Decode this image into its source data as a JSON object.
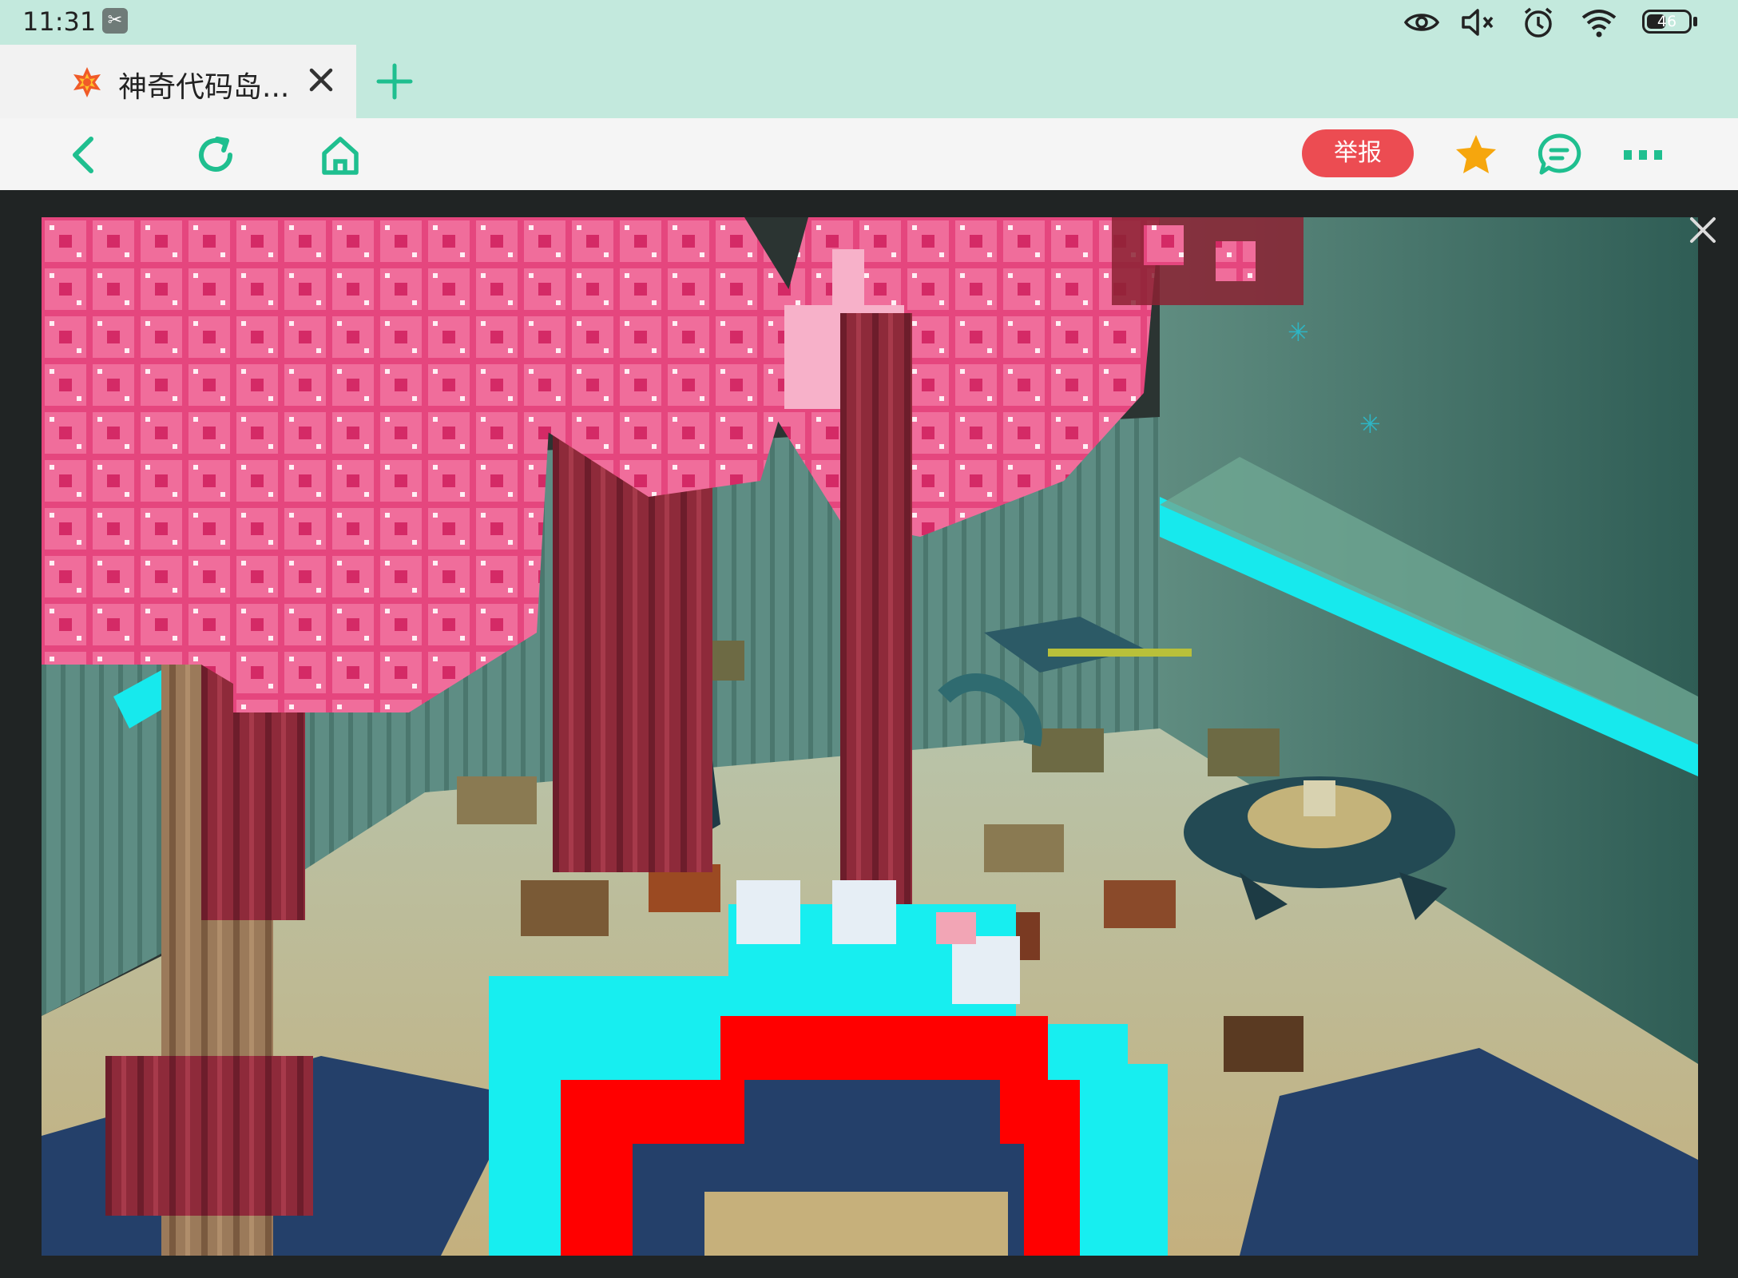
{
  "status_bar": {
    "time": "11:31",
    "battery_level": "46",
    "battery_fraction": 0.46,
    "icons": [
      "scissors-icon",
      "eye-icon",
      "mute-icon",
      "alarm-icon",
      "wifi-icon",
      "battery-icon"
    ]
  },
  "tab": {
    "title": "神奇代码岛...",
    "favicon": "code-island-favicon",
    "close_icon": "close-icon",
    "new_tab_icon": "plus-icon"
  },
  "toolbar": {
    "back_icon": "chevron-left-icon",
    "reload_icon": "reload-icon",
    "home_icon": "home-icon",
    "report_label": "举报",
    "favorite_icon": "star-icon",
    "comment_icon": "comment-icon",
    "more_icon": "more-icon"
  },
  "game_view": {
    "description_icon": "game-scene",
    "close_icon": "close-icon"
  },
  "colors": {
    "accent": "#1fbf8f",
    "report": "#ec4c52",
    "star": "#f6a60d",
    "status_bg": "#c3e9dd"
  }
}
